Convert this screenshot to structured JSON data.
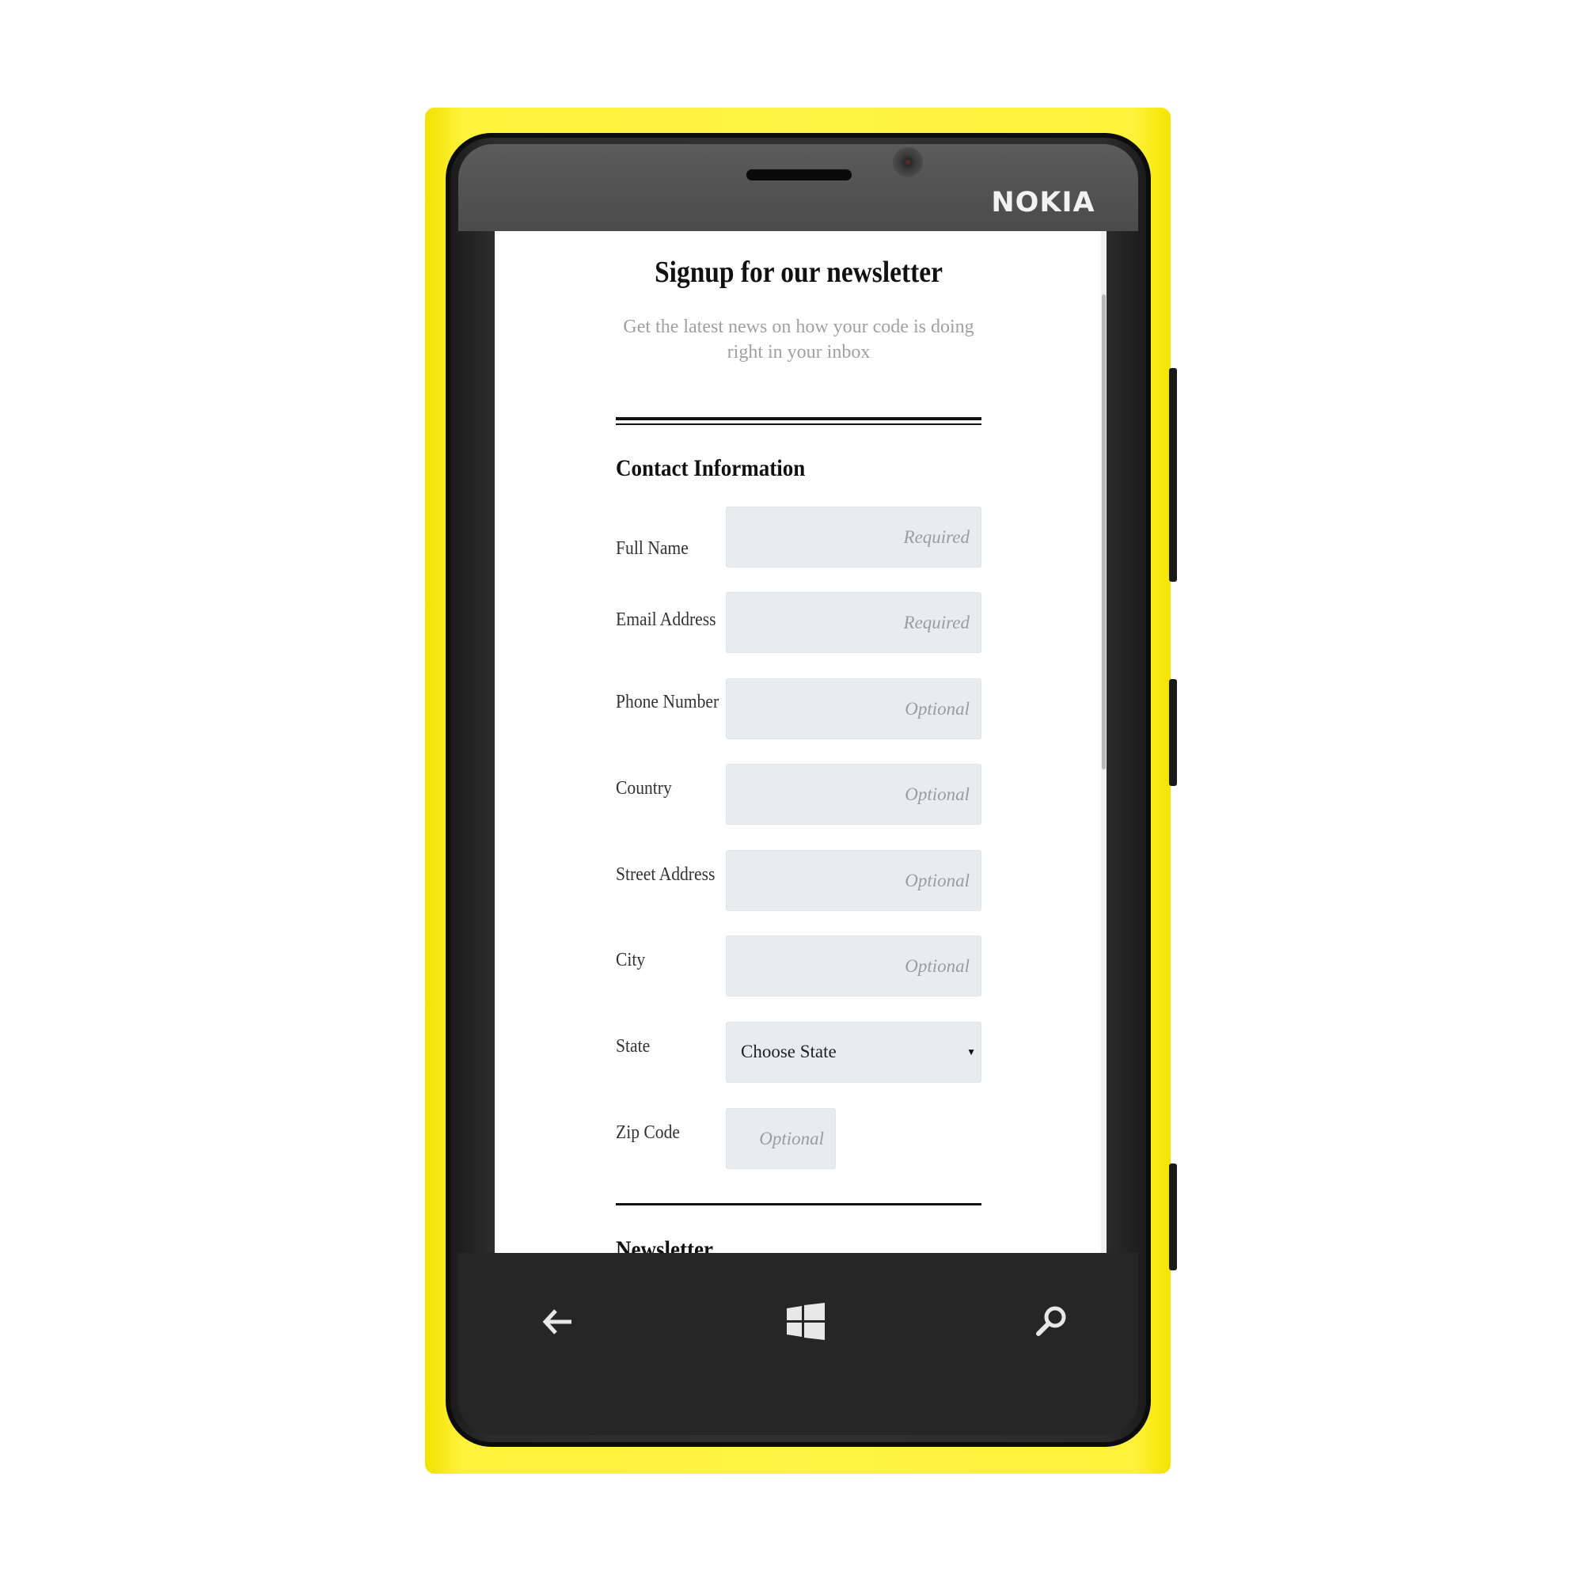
{
  "device": {
    "brand": "NOKIA",
    "body_color": "#fff345",
    "nav": {
      "back_icon": "arrow-left-icon",
      "home_icon": "windows-logo-icon",
      "search_icon": "search-icon"
    }
  },
  "form": {
    "title": "Signup for our newsletter",
    "subtitle": "Get the latest news on how your code is doing right in your inbox",
    "contact_section": "Contact Information",
    "fields": {
      "full_name": {
        "label": "Full Name",
        "placeholder": "Required"
      },
      "email": {
        "label": "Email Address",
        "placeholder": "Required"
      },
      "phone": {
        "label": "Phone Number",
        "placeholder": "Optional"
      },
      "country": {
        "label": "Country",
        "placeholder": "Optional"
      },
      "street": {
        "label": "Street Address",
        "placeholder": "Optional"
      },
      "city": {
        "label": "City",
        "placeholder": "Optional"
      },
      "state": {
        "label": "State",
        "value": "Choose State"
      },
      "zip": {
        "label": "Zip Code",
        "placeholder": "Optional"
      }
    },
    "newsletter_section": "Newsletter"
  }
}
